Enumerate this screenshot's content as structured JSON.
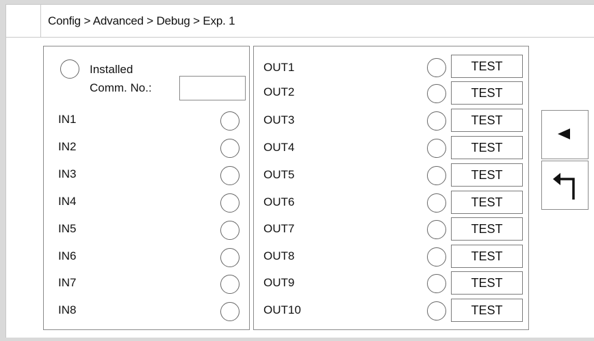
{
  "header": {
    "breadcrumb": "Config > Advanced > Debug > Exp. 1"
  },
  "inputs_panel": {
    "installed_label": "Installed",
    "comm_no_label": "Comm. No.:",
    "comm_no_value": "",
    "inputs": [
      {
        "label": "IN1"
      },
      {
        "label": "IN2"
      },
      {
        "label": "IN3"
      },
      {
        "label": "IN4"
      },
      {
        "label": "IN5"
      },
      {
        "label": "IN6"
      },
      {
        "label": "IN7"
      },
      {
        "label": "IN8"
      }
    ]
  },
  "outputs_panel": {
    "outputs": [
      {
        "label": "OUT1",
        "button": "TEST"
      },
      {
        "label": "OUT2",
        "button": "TEST"
      },
      {
        "label": "OUT3",
        "button": "TEST"
      },
      {
        "label": "OUT4",
        "button": "TEST"
      },
      {
        "label": "OUT5",
        "button": "TEST"
      },
      {
        "label": "OUT6",
        "button": "TEST"
      },
      {
        "label": "OUT7",
        "button": "TEST"
      },
      {
        "label": "OUT8",
        "button": "TEST"
      },
      {
        "label": "OUT9",
        "button": "TEST"
      },
      {
        "label": "OUT10",
        "button": "TEST"
      }
    ]
  },
  "side_buttons": {
    "previous_icon": "left-triangle-icon",
    "return_icon": "return-arrow-icon"
  }
}
